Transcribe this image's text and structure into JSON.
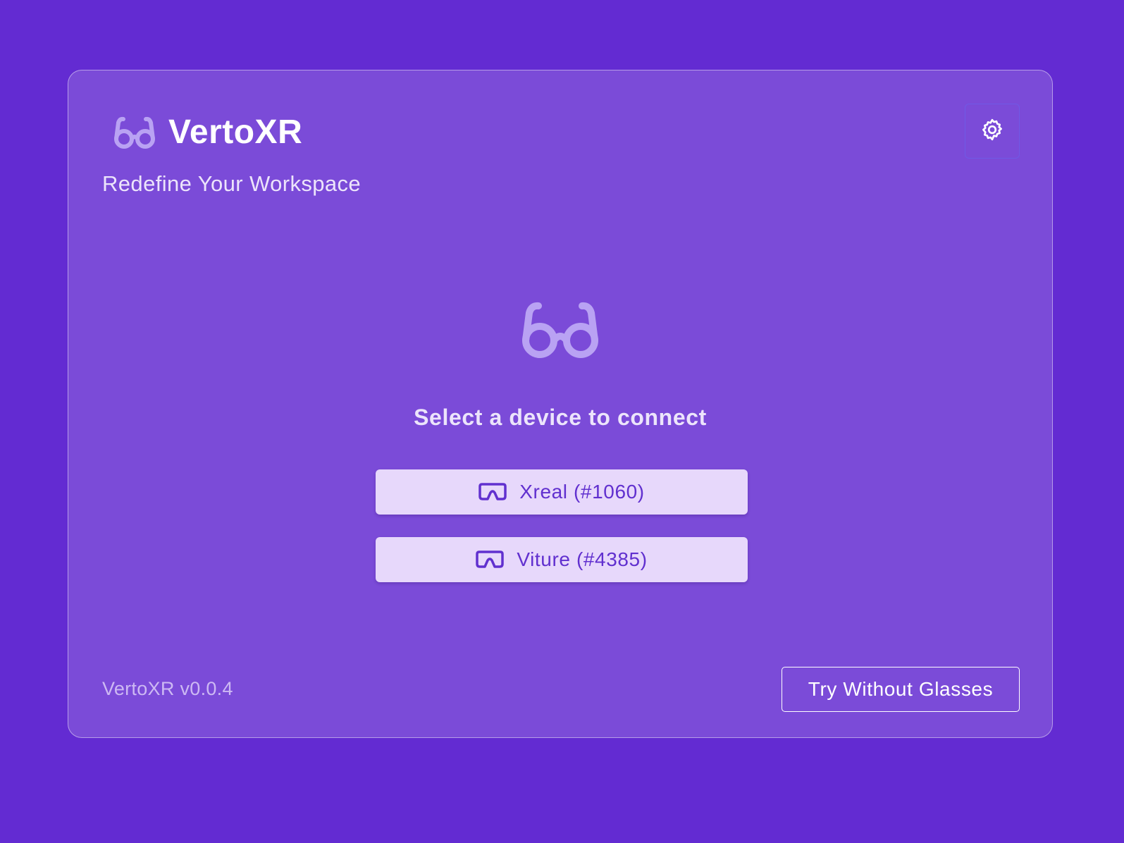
{
  "app": {
    "name": "VertoXR",
    "tagline": "Redefine Your Workspace",
    "logo_icon": "glasses-icon",
    "version": "VertoXR v0.0.4"
  },
  "header": {
    "settings_icon": "gear-icon"
  },
  "main": {
    "hero_icon": "glasses-icon",
    "prompt": "Select a device to connect",
    "devices": [
      {
        "label": "Xreal (#1060)",
        "icon": "vr-headset-icon"
      },
      {
        "label": "Viture (#4385)",
        "icon": "vr-headset-icon"
      }
    ]
  },
  "footer": {
    "try_without_label": "Try Without Glasses"
  },
  "colors": {
    "background": "#632bd2",
    "card": "#7b4bd8",
    "accent_light": "#b9a2f3",
    "button_bg": "#e7d8fb",
    "button_text": "#6130cf"
  }
}
